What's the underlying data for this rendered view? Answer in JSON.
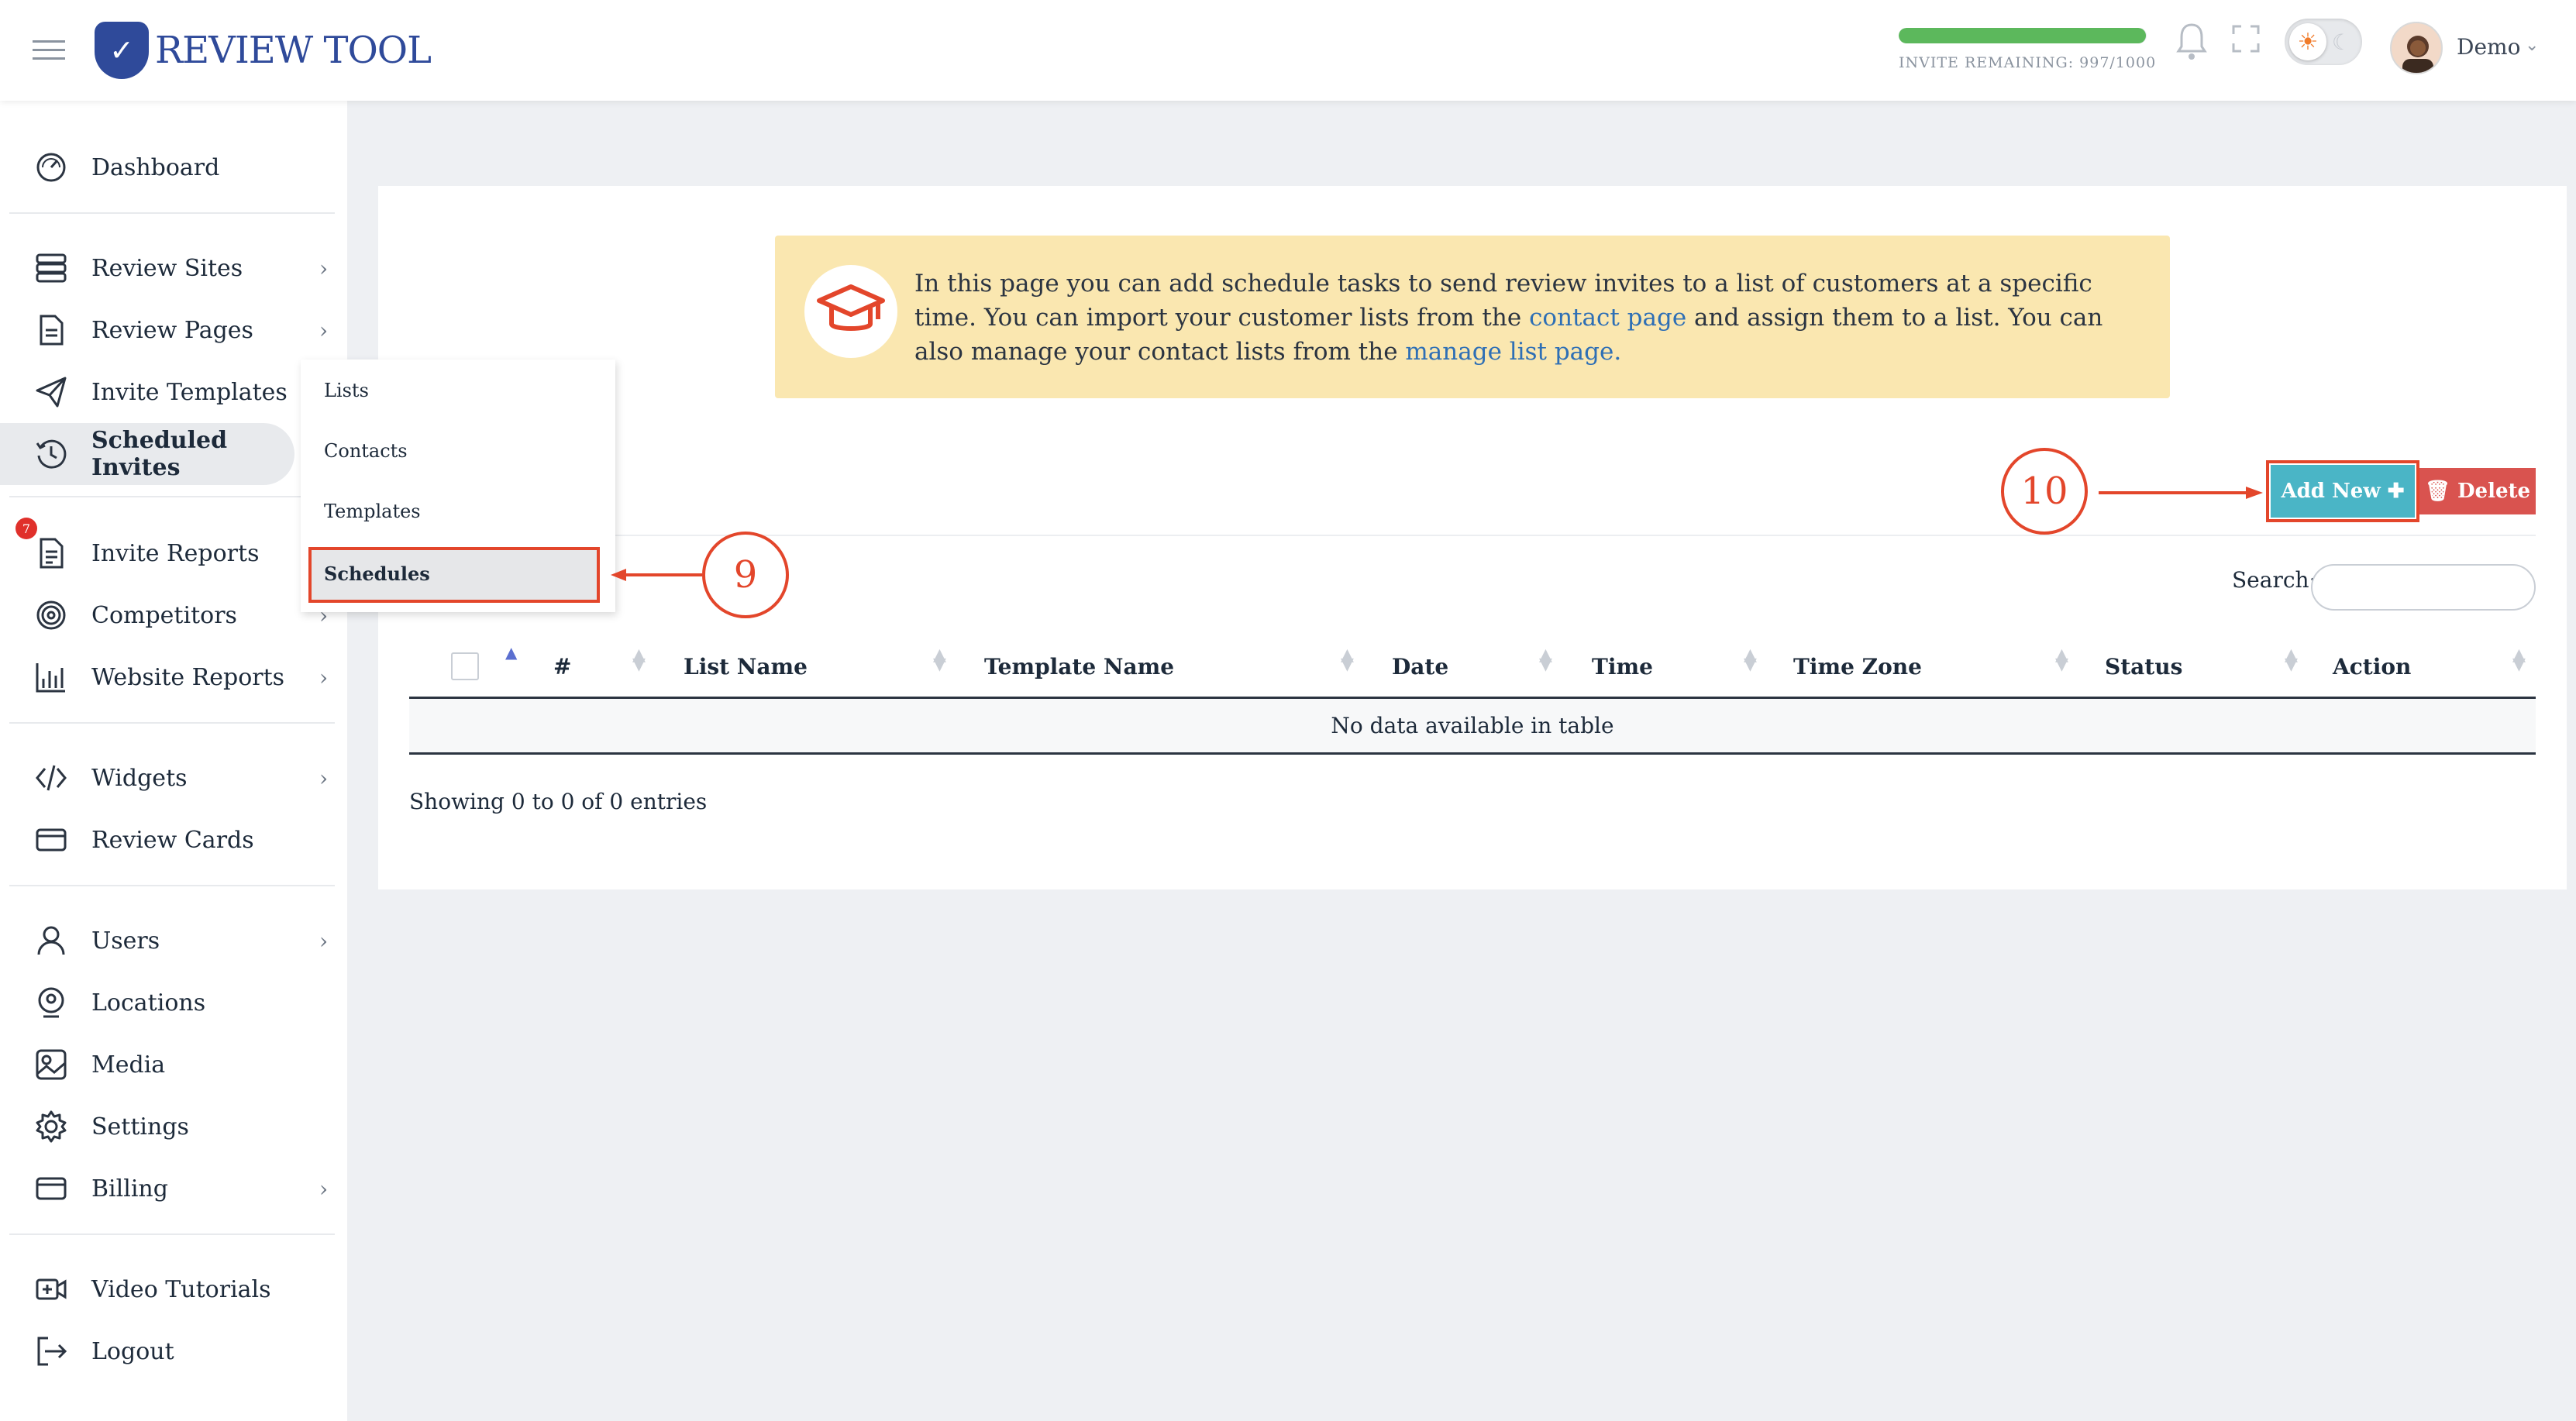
{
  "app": {
    "logo_text": "REVIEW TOOL",
    "invite_label": "INVITE REMAINING:  997/1000",
    "invite_progress_fraction": 0.997,
    "user_name": "Demo"
  },
  "sidebar": {
    "items": [
      {
        "label": "Dashboard",
        "icon": "dashboard-icon",
        "has_chevron": false
      },
      {
        "label": "Review Sites",
        "icon": "server-icon",
        "has_chevron": true
      },
      {
        "label": "Review Pages",
        "icon": "document-icon",
        "has_chevron": true
      },
      {
        "label": "Invite Templates",
        "icon": "paper-plane-icon",
        "has_chevron": false
      },
      {
        "label": "Scheduled Invites",
        "icon": "clock-history-icon",
        "has_chevron": false,
        "active": true
      },
      {
        "label": "Invite Reports",
        "icon": "report-icon",
        "has_chevron": false,
        "badge": "7"
      },
      {
        "label": "Competitors",
        "icon": "fingerprint-icon",
        "has_chevron": true
      },
      {
        "label": "Website Reports",
        "icon": "bar-chart-icon",
        "has_chevron": true
      },
      {
        "label": "Widgets",
        "icon": "code-icon",
        "has_chevron": true
      },
      {
        "label": "Review Cards",
        "icon": "card-icon",
        "has_chevron": false
      },
      {
        "label": "Users",
        "icon": "user-icon",
        "has_chevron": true
      },
      {
        "label": "Locations",
        "icon": "location-icon",
        "has_chevron": false
      },
      {
        "label": "Media",
        "icon": "image-icon",
        "has_chevron": false
      },
      {
        "label": "Settings",
        "icon": "gear-icon",
        "has_chevron": false
      },
      {
        "label": "Billing",
        "icon": "credit-card-icon",
        "has_chevron": true
      },
      {
        "label": "Video Tutorials",
        "icon": "video-icon",
        "has_chevron": false
      },
      {
        "label": "Logout",
        "icon": "logout-icon",
        "has_chevron": false
      }
    ],
    "badge_invite_reports": "7"
  },
  "submenu": {
    "items": [
      "Lists",
      "Contacts",
      "Templates",
      "Schedules"
    ],
    "selected": "Schedules"
  },
  "notice": {
    "text_1": "In this page you can add schedule tasks to send review invites to a list of customers at a specific time. You can import your customer lists from the ",
    "link_1": "contact page",
    "text_2": " and assign them to a list. You can also manage your contact lists from the ",
    "link_2": "manage list page."
  },
  "toolbar": {
    "add_label": "Add New ✚",
    "delete_label": "🗑 Delete"
  },
  "search": {
    "label": "Search:",
    "value": "",
    "placeholder": ""
  },
  "table": {
    "columns": [
      "#",
      "List Name",
      "Template Name",
      "Date",
      "Time",
      "Time Zone",
      "Status",
      "Action"
    ],
    "empty_text": "No data available in table",
    "showing": "Showing 0 to 0 of 0 entries"
  },
  "annotations": {
    "marker_9": "9",
    "marker_10": "10"
  },
  "colors": {
    "accent_annotation": "#e3462b",
    "add_button": "#4ab5c6",
    "delete_button": "#d9534f",
    "notice_bg": "#fae7b0",
    "link": "#2e6fb5",
    "brand": "#2f4a9a"
  }
}
